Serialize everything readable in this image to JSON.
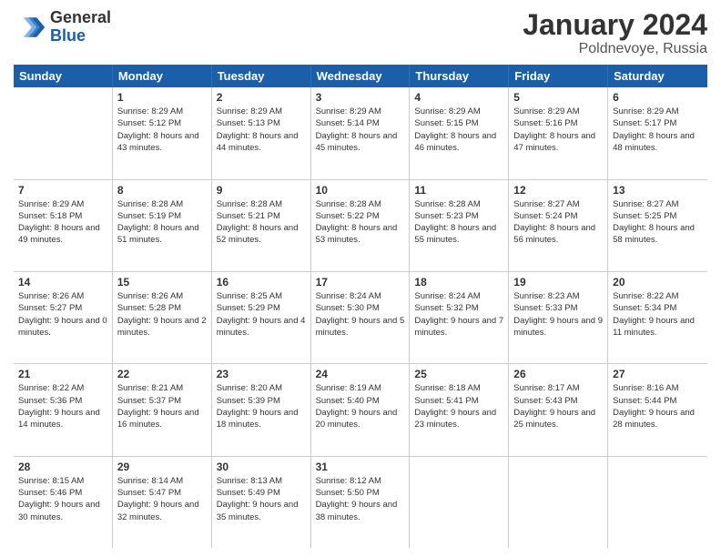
{
  "header": {
    "logo_general": "General",
    "logo_blue": "Blue",
    "month_year": "January 2024",
    "location": "Poldnevoye, Russia"
  },
  "calendar": {
    "days_of_week": [
      "Sunday",
      "Monday",
      "Tuesday",
      "Wednesday",
      "Thursday",
      "Friday",
      "Saturday"
    ],
    "weeks": [
      [
        {
          "day": "",
          "sunrise": "",
          "sunset": "",
          "daylight": ""
        },
        {
          "day": "1",
          "sunrise": "8:29 AM",
          "sunset": "5:12 PM",
          "daylight": "8 hours and 43 minutes."
        },
        {
          "day": "2",
          "sunrise": "8:29 AM",
          "sunset": "5:13 PM",
          "daylight": "8 hours and 44 minutes."
        },
        {
          "day": "3",
          "sunrise": "8:29 AM",
          "sunset": "5:14 PM",
          "daylight": "8 hours and 45 minutes."
        },
        {
          "day": "4",
          "sunrise": "8:29 AM",
          "sunset": "5:15 PM",
          "daylight": "8 hours and 46 minutes."
        },
        {
          "day": "5",
          "sunrise": "8:29 AM",
          "sunset": "5:16 PM",
          "daylight": "8 hours and 47 minutes."
        },
        {
          "day": "6",
          "sunrise": "8:29 AM",
          "sunset": "5:17 PM",
          "daylight": "8 hours and 48 minutes."
        }
      ],
      [
        {
          "day": "7",
          "sunrise": "8:29 AM",
          "sunset": "5:18 PM",
          "daylight": "8 hours and 49 minutes."
        },
        {
          "day": "8",
          "sunrise": "8:28 AM",
          "sunset": "5:19 PM",
          "daylight": "8 hours and 51 minutes."
        },
        {
          "day": "9",
          "sunrise": "8:28 AM",
          "sunset": "5:21 PM",
          "daylight": "8 hours and 52 minutes."
        },
        {
          "day": "10",
          "sunrise": "8:28 AM",
          "sunset": "5:22 PM",
          "daylight": "8 hours and 53 minutes."
        },
        {
          "day": "11",
          "sunrise": "8:28 AM",
          "sunset": "5:23 PM",
          "daylight": "8 hours and 55 minutes."
        },
        {
          "day": "12",
          "sunrise": "8:27 AM",
          "sunset": "5:24 PM",
          "daylight": "8 hours and 56 minutes."
        },
        {
          "day": "13",
          "sunrise": "8:27 AM",
          "sunset": "5:25 PM",
          "daylight": "8 hours and 58 minutes."
        }
      ],
      [
        {
          "day": "14",
          "sunrise": "8:26 AM",
          "sunset": "5:27 PM",
          "daylight": "9 hours and 0 minutes."
        },
        {
          "day": "15",
          "sunrise": "8:26 AM",
          "sunset": "5:28 PM",
          "daylight": "9 hours and 2 minutes."
        },
        {
          "day": "16",
          "sunrise": "8:25 AM",
          "sunset": "5:29 PM",
          "daylight": "9 hours and 4 minutes."
        },
        {
          "day": "17",
          "sunrise": "8:24 AM",
          "sunset": "5:30 PM",
          "daylight": "9 hours and 5 minutes."
        },
        {
          "day": "18",
          "sunrise": "8:24 AM",
          "sunset": "5:32 PM",
          "daylight": "9 hours and 7 minutes."
        },
        {
          "day": "19",
          "sunrise": "8:23 AM",
          "sunset": "5:33 PM",
          "daylight": "9 hours and 9 minutes."
        },
        {
          "day": "20",
          "sunrise": "8:22 AM",
          "sunset": "5:34 PM",
          "daylight": "9 hours and 11 minutes."
        }
      ],
      [
        {
          "day": "21",
          "sunrise": "8:22 AM",
          "sunset": "5:36 PM",
          "daylight": "9 hours and 14 minutes."
        },
        {
          "day": "22",
          "sunrise": "8:21 AM",
          "sunset": "5:37 PM",
          "daylight": "9 hours and 16 minutes."
        },
        {
          "day": "23",
          "sunrise": "8:20 AM",
          "sunset": "5:39 PM",
          "daylight": "9 hours and 18 minutes."
        },
        {
          "day": "24",
          "sunrise": "8:19 AM",
          "sunset": "5:40 PM",
          "daylight": "9 hours and 20 minutes."
        },
        {
          "day": "25",
          "sunrise": "8:18 AM",
          "sunset": "5:41 PM",
          "daylight": "9 hours and 23 minutes."
        },
        {
          "day": "26",
          "sunrise": "8:17 AM",
          "sunset": "5:43 PM",
          "daylight": "9 hours and 25 minutes."
        },
        {
          "day": "27",
          "sunrise": "8:16 AM",
          "sunset": "5:44 PM",
          "daylight": "9 hours and 28 minutes."
        }
      ],
      [
        {
          "day": "28",
          "sunrise": "8:15 AM",
          "sunset": "5:46 PM",
          "daylight": "9 hours and 30 minutes."
        },
        {
          "day": "29",
          "sunrise": "8:14 AM",
          "sunset": "5:47 PM",
          "daylight": "9 hours and 32 minutes."
        },
        {
          "day": "30",
          "sunrise": "8:13 AM",
          "sunset": "5:49 PM",
          "daylight": "9 hours and 35 minutes."
        },
        {
          "day": "31",
          "sunrise": "8:12 AM",
          "sunset": "5:50 PM",
          "daylight": "9 hours and 38 minutes."
        },
        {
          "day": "",
          "sunrise": "",
          "sunset": "",
          "daylight": ""
        },
        {
          "day": "",
          "sunrise": "",
          "sunset": "",
          "daylight": ""
        },
        {
          "day": "",
          "sunrise": "",
          "sunset": "",
          "daylight": ""
        }
      ]
    ],
    "labels": {
      "sunrise": "Sunrise:",
      "sunset": "Sunset:",
      "daylight": "Daylight:"
    }
  }
}
